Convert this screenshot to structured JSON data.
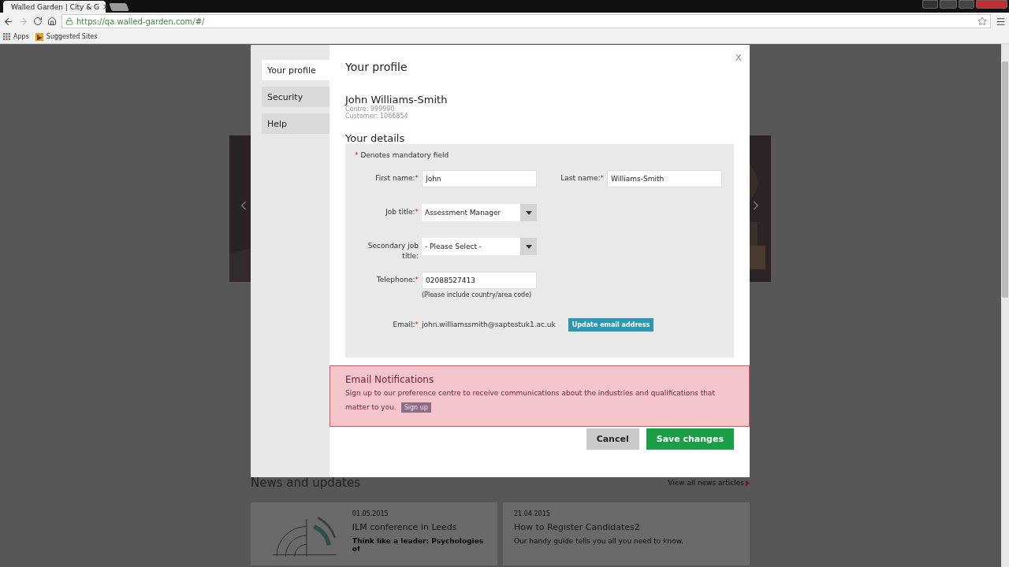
{
  "browser": {
    "tab_title": "Walled Garden | City & G",
    "tab_close": "×",
    "url": "https://qa.walled-garden.com/#/",
    "bookmarks": [
      {
        "kind": "apps",
        "label": "Apps"
      },
      {
        "kind": "site",
        "label": "Suggested Sites"
      }
    ]
  },
  "page": {
    "news": {
      "title": "News and updates",
      "link": "View all news articles",
      "articles": [
        {
          "date": "01.05.2015",
          "title": "ILM conference in Leeds",
          "summary": "Think like a leader: Psychologies of",
          "image": true
        },
        {
          "date": "21.04.2015",
          "title": "How to Register Candidates2",
          "summary": "Our handy guide tells you all you need to know."
        }
      ]
    }
  },
  "modal": {
    "close": "x",
    "nav": [
      {
        "label": "Your profile",
        "selected": true
      },
      {
        "label": "Security",
        "selected": false
      },
      {
        "label": "Help",
        "selected": false
      }
    ],
    "title": "Your profile",
    "user": {
      "name": "John Williams-Smith",
      "centre": "Centre: 999990",
      "customer": "Customer: 1066854"
    },
    "details": {
      "title": "Your details",
      "mandatory_mark": "*",
      "mandatory_note": "Denotes mandatory field",
      "rows": [
        {
          "fields": [
            {
              "kind": "text",
              "label": "First name:",
              "mark": "*",
              "value": "John"
            },
            {
              "kind": "text",
              "label": "Last name:",
              "mark": "*",
              "value": "Williams-Smith"
            }
          ]
        },
        {
          "fields": [
            {
              "kind": "select",
              "label": "Job title:",
              "mark": "*",
              "value": "Assessment Manager"
            }
          ]
        },
        {
          "fields": [
            {
              "kind": "select",
              "label": "Secondary job title:",
              "value": "- Please Select -"
            }
          ]
        },
        {
          "fields": [
            {
              "kind": "text",
              "label": "Telephone:",
              "mark": "*",
              "value": "02088527413",
              "hint": "(Please include country/area code)"
            }
          ]
        }
      ],
      "email": {
        "label": "Email:",
        "mark": "*",
        "value": "john.williamssmith@saptestuk1.ac.uk",
        "button": "Update email address"
      }
    },
    "notifications": {
      "title": "Email Notifications",
      "text_lines": [
        "Sign up to our preference centre to receive communications about the industries and qualifications that",
        "matter to you."
      ],
      "button": "Sign up"
    },
    "actions": {
      "cancel": "Cancel",
      "save": "Save changes"
    }
  }
}
